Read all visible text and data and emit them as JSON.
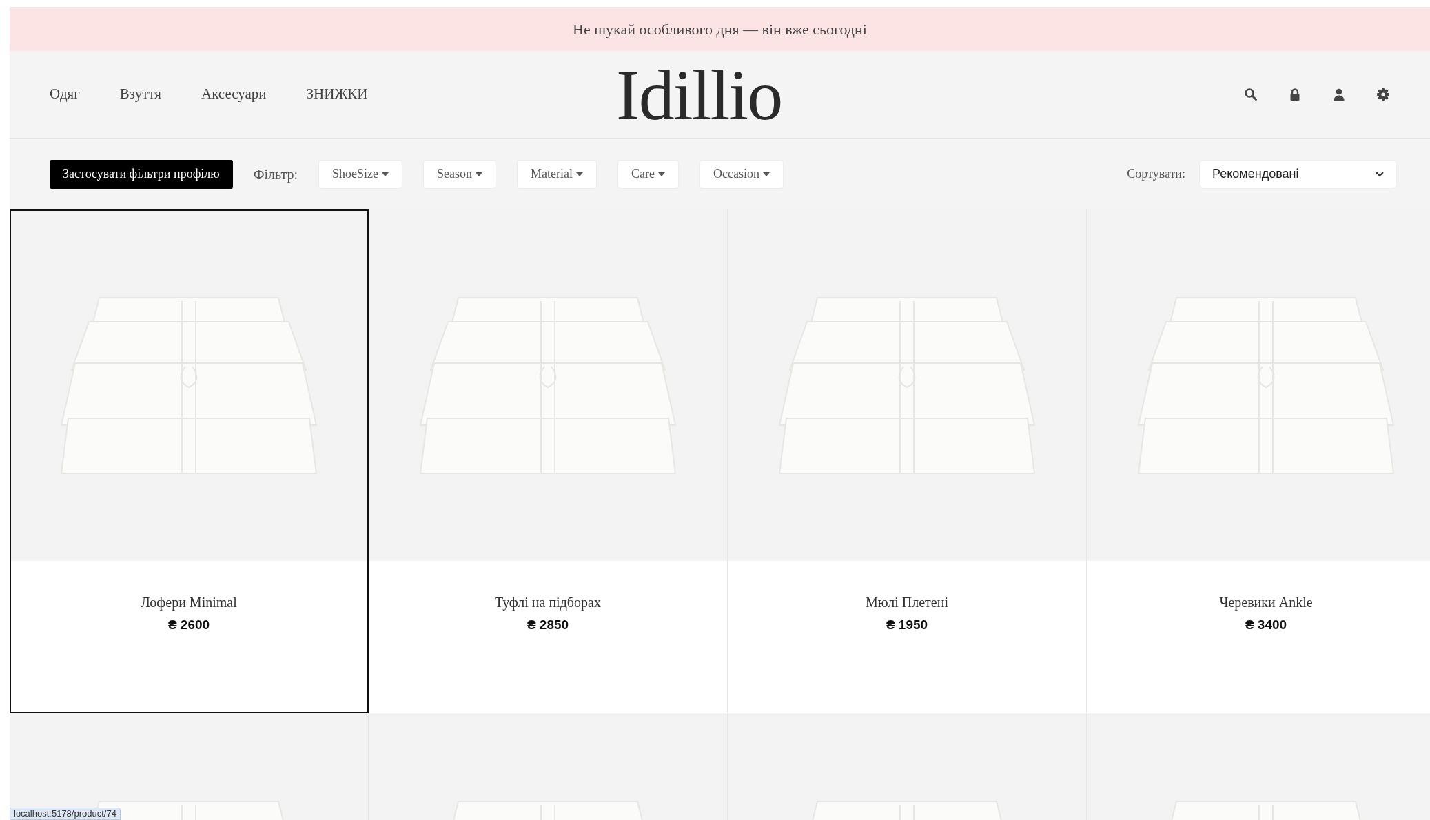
{
  "announcement": "Не шукай особливого дня — він вже сьогодні",
  "nav": [
    {
      "label": "Одяг"
    },
    {
      "label": "Взуття"
    },
    {
      "label": "Аксесуари"
    },
    {
      "label": "ЗНИЖКИ"
    }
  ],
  "logo": "Idillio",
  "header_icons": [
    {
      "kind": "search"
    },
    {
      "kind": "lock"
    },
    {
      "kind": "user"
    },
    {
      "kind": "settings"
    }
  ],
  "filter_bar": {
    "apply_button": "Застосувати фільтри профілю",
    "filter_label": "Фільтр:",
    "filters": [
      {
        "label": "ShoeSize"
      },
      {
        "label": "Season"
      },
      {
        "label": "Material"
      },
      {
        "label": "Care"
      },
      {
        "label": "Occasion"
      }
    ],
    "sort_label": "Сортувати:",
    "sort_value": "Рекомендовані"
  },
  "products": [
    {
      "name": "Лофери Minimal",
      "price": "₴ 2600",
      "selected": true
    },
    {
      "name": "Туфлі на підборах",
      "price": "₴ 2850",
      "selected": false
    },
    {
      "name": "Мюлі Плетені",
      "price": "₴ 1950",
      "selected": false
    },
    {
      "name": "Черевики Ankle",
      "price": "₴ 3400",
      "selected": false
    },
    {
      "selected": false
    },
    {
      "selected": false
    },
    {
      "selected": false
    },
    {
      "selected": false
    }
  ],
  "status_bar": {
    "url": "localhost:5178/product/74"
  }
}
